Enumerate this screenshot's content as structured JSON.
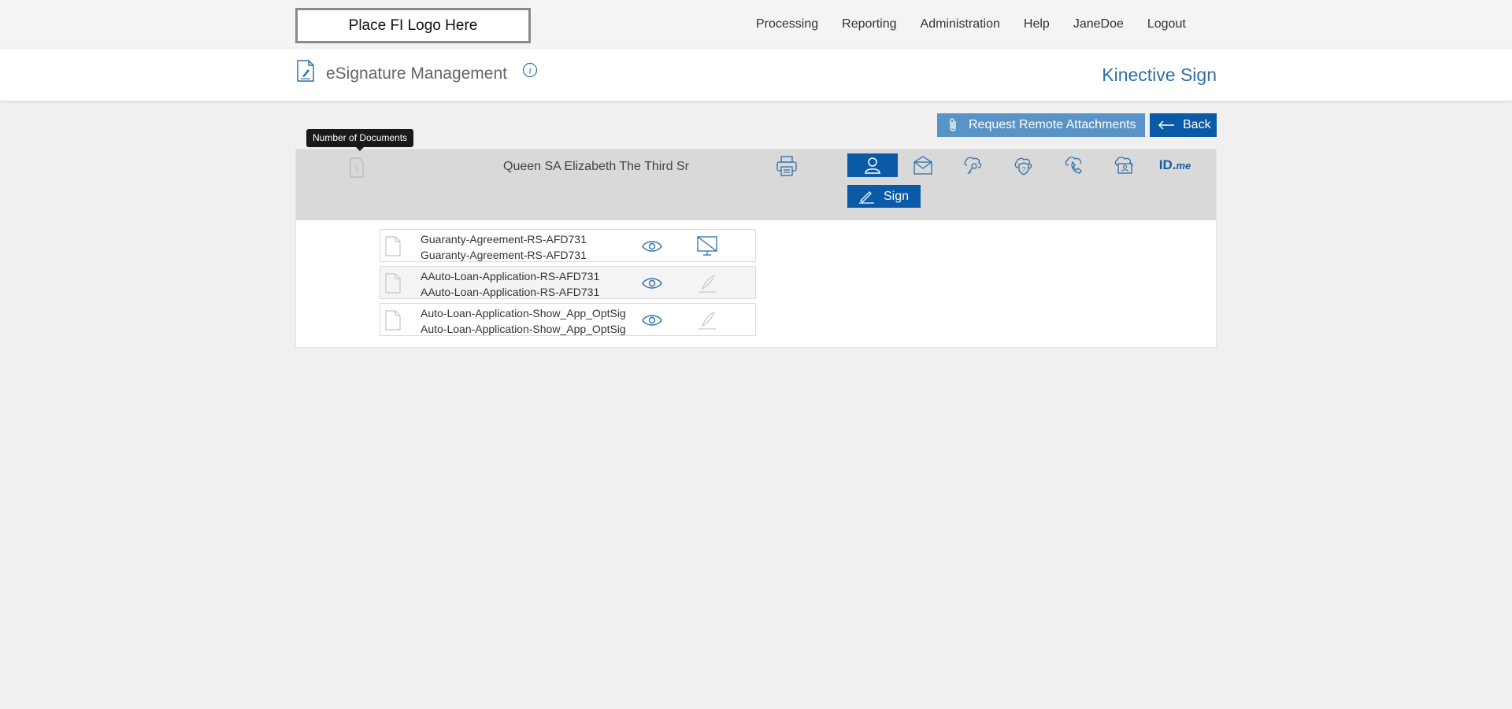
{
  "topbar": {
    "logo_text": "Place FI Logo Here",
    "nav": [
      "Processing",
      "Reporting",
      "Administration",
      "Help",
      "JaneDoe",
      "Logout"
    ]
  },
  "header": {
    "title": "eSignature Management",
    "brand": "Kinective Sign",
    "icons": [
      "document-sign-icon",
      "info-icon"
    ]
  },
  "actions": {
    "request_attachments_label": "Request Remote Attachments",
    "back_label": "Back"
  },
  "tooltip": {
    "text": "Number of Documents"
  },
  "signer": {
    "name": "Queen SA Elizabeth The Third Sr",
    "auth_methods": [
      {
        "icon": "person-icon",
        "selected": true
      },
      {
        "icon": "email-icon",
        "selected": false
      },
      {
        "icon": "key-icon",
        "selected": false
      },
      {
        "icon": "security-question-icon",
        "selected": false
      },
      {
        "icon": "phone-icon",
        "selected": false
      },
      {
        "icon": "id-verification-icon",
        "selected": false
      },
      {
        "icon": "idme-icon",
        "label": "ID.",
        "label_suffix": "me",
        "selected": false
      }
    ],
    "sign_label": "Sign"
  },
  "documents": [
    {
      "line1": "Guaranty-Agreement-RS-AFD731",
      "line2": "Guaranty-Agreement-RS-AFD731",
      "action_icon": "no-sign-monitor-icon"
    },
    {
      "line1": "AAuto-Loan-Application-RS-AFD731",
      "line2": "AAuto-Loan-Application-RS-AFD731",
      "action_icon": "pen-icon"
    },
    {
      "line1": "Auto-Loan-Application-Show_App_OptSig",
      "line2": "Auto-Loan-Application-Show_App_OptSig",
      "action_icon": "pen-icon"
    }
  ],
  "colors": {
    "primary": "#0a5aa8",
    "secondary": "#5a93c6",
    "brand_text": "#2f6fa8",
    "panel_head": "#d9d9d9"
  }
}
